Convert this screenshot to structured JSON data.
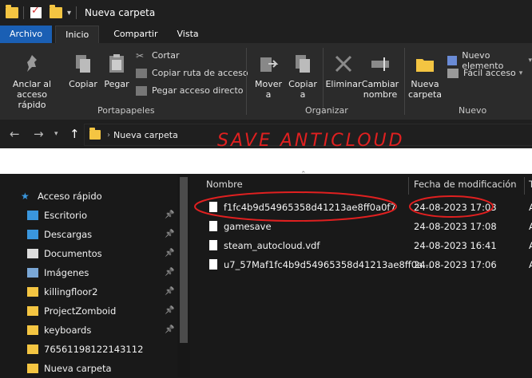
{
  "window": {
    "title": "Nueva carpeta"
  },
  "ribbon_tabs": [
    "Archivo",
    "Inicio",
    "Compartir",
    "Vista"
  ],
  "ribbon": {
    "pin_label": "Anclar al\nacceso rápido",
    "copy_label": "Copiar",
    "paste_label": "Pegar",
    "cut_label": "Cortar",
    "copy_path_label": "Copiar ruta de acceso",
    "paste_shortcut_label": "Pegar acceso directo",
    "portapapeles_label": "Portapapeles",
    "move_to_label": "Mover\na",
    "copy_to_label": "Copiar\na",
    "delete_label": "Eliminar",
    "rename_label": "Cambiar\nnombre",
    "organize_label": "Organizar",
    "new_folder_label": "Nueva\ncarpeta",
    "new_item_label": "Nuevo elemento",
    "easy_access_label": "Fácil acceso",
    "new_label": "Nuevo"
  },
  "address": {
    "crumb": "Nueva carpeta",
    "annotation": "SAVE ANTICLOUD"
  },
  "sidebar": [
    {
      "label": "Acceso rápido",
      "icon": "star-icon",
      "pinned": false
    },
    {
      "label": "Escritorio",
      "icon": "desktop-icon",
      "pinned": true
    },
    {
      "label": "Descargas",
      "icon": "download-icon",
      "pinned": true
    },
    {
      "label": "Documentos",
      "icon": "document-icon",
      "pinned": true
    },
    {
      "label": "Imágenes",
      "icon": "image-icon",
      "pinned": true
    },
    {
      "label": "killingfloor2",
      "icon": "folder-icon",
      "pinned": true
    },
    {
      "label": "ProjectZomboid",
      "icon": "folder-icon",
      "pinned": true
    },
    {
      "label": "keyboards",
      "icon": "folder-icon",
      "pinned": true
    },
    {
      "label": "76561198122143112",
      "icon": "folder-icon",
      "pinned": false
    },
    {
      "label": "Nueva carpeta",
      "icon": "folder-icon",
      "pinned": false
    }
  ],
  "columns": {
    "name": "Nombre",
    "date": "Fecha de modificación",
    "type": "T"
  },
  "files": [
    {
      "name": "f1fc4b9d54965358d41213ae8ff0a0f7",
      "date": "24-08-2023 17:03",
      "type": "A"
    },
    {
      "name": "gamesave",
      "date": "24-08-2023 17:08",
      "type": "A"
    },
    {
      "name": "steam_autocloud.vdf",
      "date": "24-08-2023 16:41",
      "type": "A"
    },
    {
      "name": "u7_57Maf1fc4b9d54965358d41213ae8ff0a...",
      "date": "24-08-2023 17:06",
      "type": "A"
    }
  ],
  "colors": {
    "accent": "#1a5fb4",
    "folder": "#f4c542",
    "annotation": "#e02020"
  }
}
